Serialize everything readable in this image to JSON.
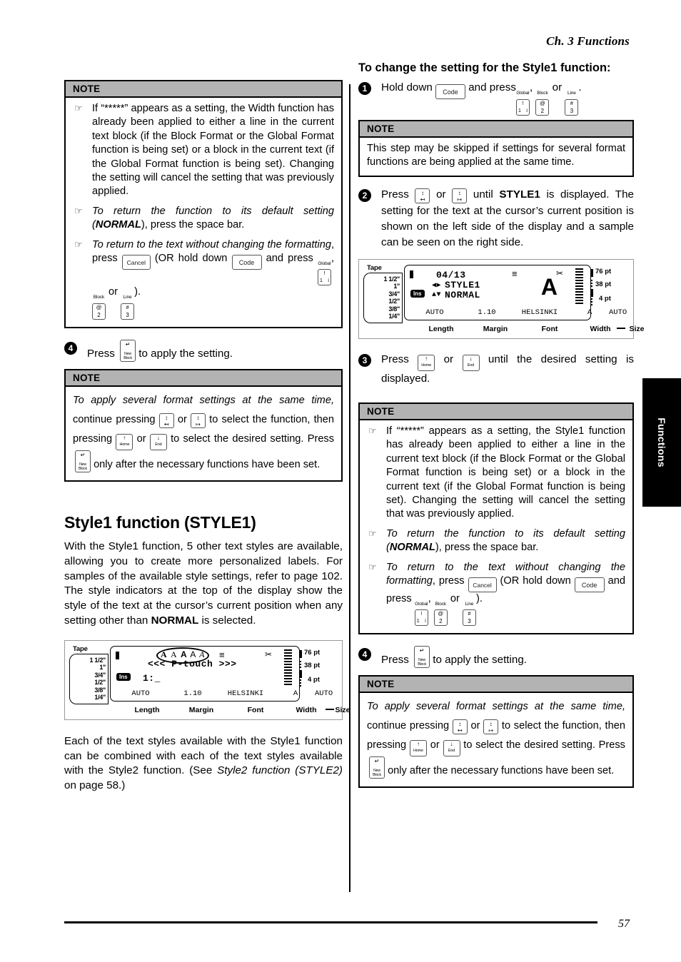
{
  "running_head": "Ch. 3 Functions",
  "folio": "57",
  "side_tab": {
    "label": "Functions"
  },
  "note_label": "NOTE",
  "keys": {
    "code": "Code",
    "cancel": "Cancel",
    "global_cap": "Global",
    "block_cap": "Block",
    "line_cap": "Line",
    "key1_top": "!",
    "key1_bot_left": "1",
    "key1_bot_right": "i",
    "key2_top": "@",
    "key2_bot": "2",
    "key3_top": "#",
    "key3_bot": "3",
    "home": "Home",
    "end": "End",
    "newblock_l1": "New",
    "newblock_l2": "Block",
    "enter_arrow": "↵",
    "up_arrow": "↑",
    "down_arrow": "↓"
  },
  "left_column": {
    "note_width": {
      "bullets": [
        {
          "text_parts": [
            {
              "t": "If “*****” appears as a setting, the Width function has already been applied to either a line in the current text block (if the Block Format or the Global Format function is being set) or a block in the current text (if the Global Format function is being set). Changing the setting will cancel the setting that was previously applied."
            }
          ]
        },
        {
          "lead_italic": "To return the function to its default setting (",
          "bold_italic": "NORMAL",
          "tail": "), press the space bar."
        },
        {
          "lead_italic": "To return to the text without changing the formatting",
          "mid1": ", press ",
          "mid2": " (OR hold down ",
          "mid3": " and press ",
          "sep1": ", ",
          "sep2": " or ",
          "tail": ")."
        }
      ]
    },
    "step4": {
      "number": "4",
      "before": "Press",
      "after": "to apply the setting."
    },
    "note_multi": {
      "line1_italic": "To apply several format settings at the same time,",
      "line2a": "continue pressing",
      "line2b": "or",
      "line2c": "to select the function,",
      "line3a": "then pressing",
      "line3b": "or",
      "line3c": "to select the desired setting.",
      "line4a": "Press",
      "line4b": "only after the necessary functions have been set."
    },
    "heading": "Style1 function (STYLE1)",
    "intro_a": "With the Style1 function, 5 other text styles are available, allowing you to create more personalized labels. For samples of the available style settings, refer to page 102. The style indicators at the top of the display show the style of the text at the cursor’s current position when any setting other than ",
    "intro_bold": "NORMAL",
    "intro_b": " is selected.",
    "outro_a": "Each of the text styles available with the Style1 function can be combined with each of the text styles available with the Style2 function. (See ",
    "outro_italic": "Style2 function (STYLE2)",
    "outro_b": " on page 58.)"
  },
  "right_column": {
    "heading": "To change the setting for the Style1 function:",
    "step1": {
      "number": "1",
      "a": "Hold down",
      "b": "and press",
      "sep1": ",",
      "sep2": "or",
      "tail": "."
    },
    "note_skip": "This step may be skipped if settings for several format functions are being applied at the same time.",
    "step2": {
      "number": "2",
      "a": "Press",
      "b": "or",
      "c": "until ",
      "bold": "STYLE1",
      "d": " is displayed. The setting for the text at the cursor’s current position is shown on the left side of the display and a sample can be seen on the right side."
    },
    "step3": {
      "number": "3",
      "a": "Press",
      "b": "or",
      "c": "until the desired setting is displayed."
    },
    "note_style1": {
      "bullets": [
        {
          "text": "If “*****” appears as a setting, the Style1 function has already been applied to either a line in the current text block (if the Block Format or the Global Format function is being set) or a block in the current text (if the Global Format function is being set). Changing the setting will cancel the setting that was previously applied."
        },
        {
          "lead_italic": "To return the function to its default setting (",
          "bold_italic": "NORMAL",
          "tail": "), press the space bar."
        },
        {
          "lead_italic": "To return to the text without changing the formatting",
          "mid1": ", press ",
          "mid2": " (OR hold down ",
          "mid3": " and press ",
          "sep1": ", ",
          "sep2": " or ",
          "tail": ")."
        }
      ]
    },
    "step4": {
      "number": "4",
      "before": "Press",
      "after": "to apply the setting."
    },
    "note_multi": {
      "line1_italic": "To apply several format settings at the same time,",
      "line2a": "continue pressing",
      "line2b": "or",
      "line2c": "to select the function,",
      "line3a": "then pressing",
      "line3b": "or",
      "line3c": "to select the desired setting.",
      "line4a": "Press",
      "line4b": "only after the necessary functions have been set."
    }
  },
  "lcd_left": {
    "tape_label": "Tape",
    "tape_widths": [
      "1 1/2\"",
      "1\"",
      "3/4\"",
      "1/2\"",
      "3/8\"",
      "1/4\""
    ],
    "pt_scale": [
      "76 pt",
      "38 pt",
      "4 pt"
    ],
    "style_indicators": "A A A A A",
    "main_text": "<<< P-touch >>>",
    "line_text": "1:_",
    "ins": "Ins",
    "status": [
      "AUTO",
      "1.10",
      "HELSINKI",
      "A",
      "AUTO"
    ],
    "legend": [
      "Length",
      "Margin",
      "Font",
      "Width",
      "Size"
    ]
  },
  "lcd_right": {
    "tape_label": "Tape",
    "tape_widths": [
      "1 1/2\"",
      "1\"",
      "3/4\"",
      "1/2\"",
      "3/8\"",
      "1/4\""
    ],
    "pt_scale": [
      "76 pt",
      "38 pt",
      "4 pt"
    ],
    "counter": "04/13",
    "function_name": "STYLE1",
    "setting_value": "NORMAL",
    "sample_char": "A",
    "ins": "Ins",
    "status": [
      "AUTO",
      "1.10",
      "HELSINKI",
      "A",
      "AUTO"
    ],
    "legend": [
      "Length",
      "Margin",
      "Font",
      "Width",
      "Size"
    ],
    "lr_arrows": "◀▶",
    "ud_arrows": "▲▼"
  }
}
